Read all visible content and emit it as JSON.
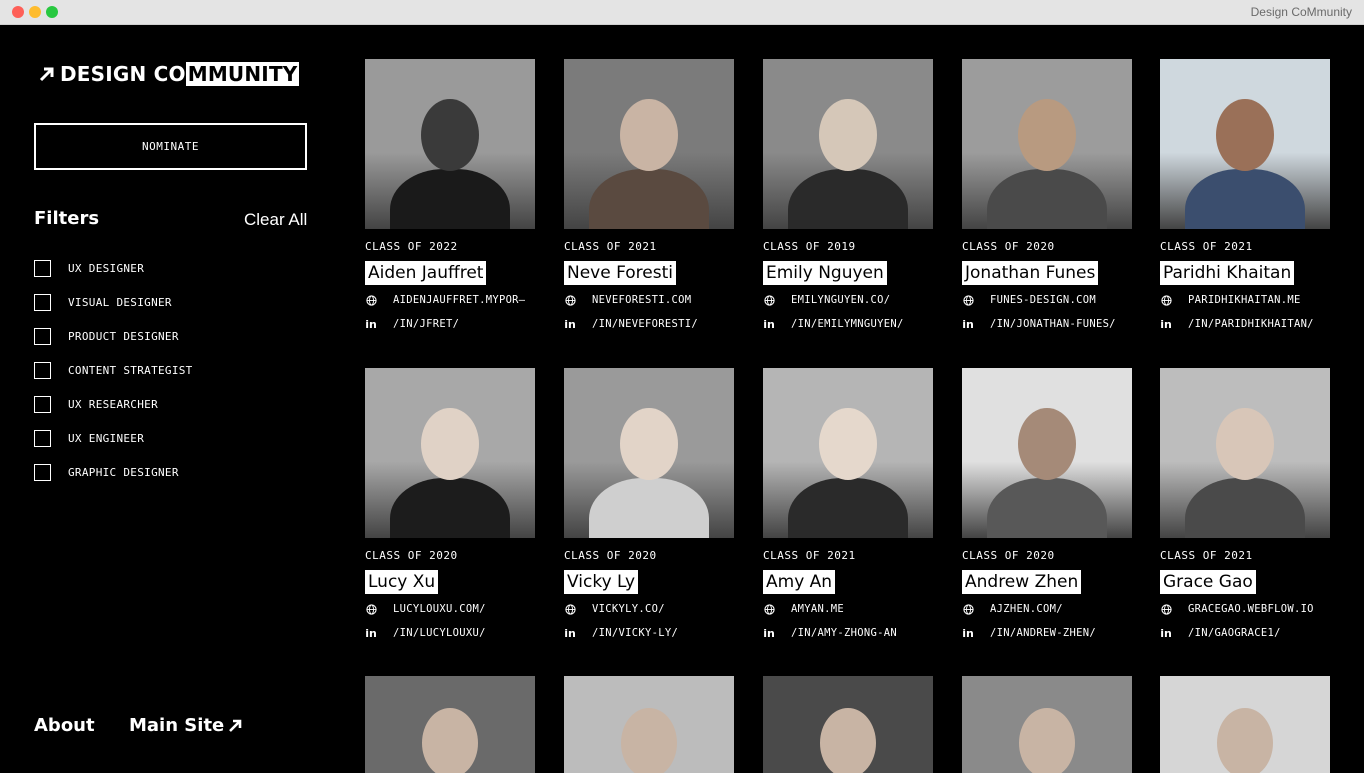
{
  "window": {
    "title": "Design CoMmunity"
  },
  "logo": {
    "part1": "DESIGN CO",
    "part2": "MMUNITY"
  },
  "sidebar": {
    "nominate_label": "NOMINATE",
    "filters_title": "Filters",
    "clear_all_label": "Clear All",
    "filters": [
      {
        "label": "UX DESIGNER"
      },
      {
        "label": "VISUAL DESIGNER"
      },
      {
        "label": "PRODUCT DESIGNER"
      },
      {
        "label": "CONTENT STRATEGIST"
      },
      {
        "label": "UX RESEARCHER"
      },
      {
        "label": "UX ENGINEER"
      },
      {
        "label": "GRAPHIC DESIGNER"
      }
    ],
    "about_label": "About",
    "main_site_label": "Main Site"
  },
  "members": [
    {
      "class": "CLASS OF 2022",
      "name": "Aiden Jauffret",
      "website": "AIDENJAUFFRET.MYPOR–",
      "linkedin": "/IN/JFRET/"
    },
    {
      "class": "CLASS OF 2021",
      "name": "Neve Foresti",
      "website": "NEVEFORESTI.COM",
      "linkedin": "/IN/NEVEFORESTI/"
    },
    {
      "class": "CLASS OF 2019",
      "name": "Emily Nguyen",
      "website": "EMILYNGUYEN.CO/",
      "linkedin": "/IN/EMILYMNGUYEN/"
    },
    {
      "class": "CLASS OF 2020",
      "name": "Jonathan Funes",
      "website": "FUNES-DESIGN.COM",
      "linkedin": "/IN/JONATHAN-FUNES/"
    },
    {
      "class": "CLASS OF 2021",
      "name": "Paridhi Khaitan",
      "website": "PARIDHIKHAITAN.ME",
      "linkedin": "/IN/PARIDHIKHAITAN/"
    },
    {
      "class": "CLASS OF 2020",
      "name": "Lucy Xu",
      "website": "LUCYLOUXU.COM/",
      "linkedin": "/IN/LUCYLOUXU/"
    },
    {
      "class": "CLASS OF 2020",
      "name": "Vicky Ly",
      "website": "VICKYLY.CO/",
      "linkedin": "/IN/VICKY-LY/"
    },
    {
      "class": "CLASS OF 2021",
      "name": "Amy An",
      "website": "AMYAN.ME",
      "linkedin": "/IN/AMY-ZHONG-AN"
    },
    {
      "class": "CLASS OF 2020",
      "name": "Andrew Zhen",
      "website": "AJZHEN.COM/",
      "linkedin": "/IN/ANDREW-ZHEN/"
    },
    {
      "class": "CLASS OF 2021",
      "name": "Grace Gao",
      "website": "GRACEGAO.WEBFLOW.IO",
      "linkedin": "/IN/GAOGRACE1/"
    }
  ],
  "icons": {
    "website": "globe-icon",
    "linkedin": "linkedin-icon",
    "logo_arrow": "arrow-up-right-icon"
  }
}
